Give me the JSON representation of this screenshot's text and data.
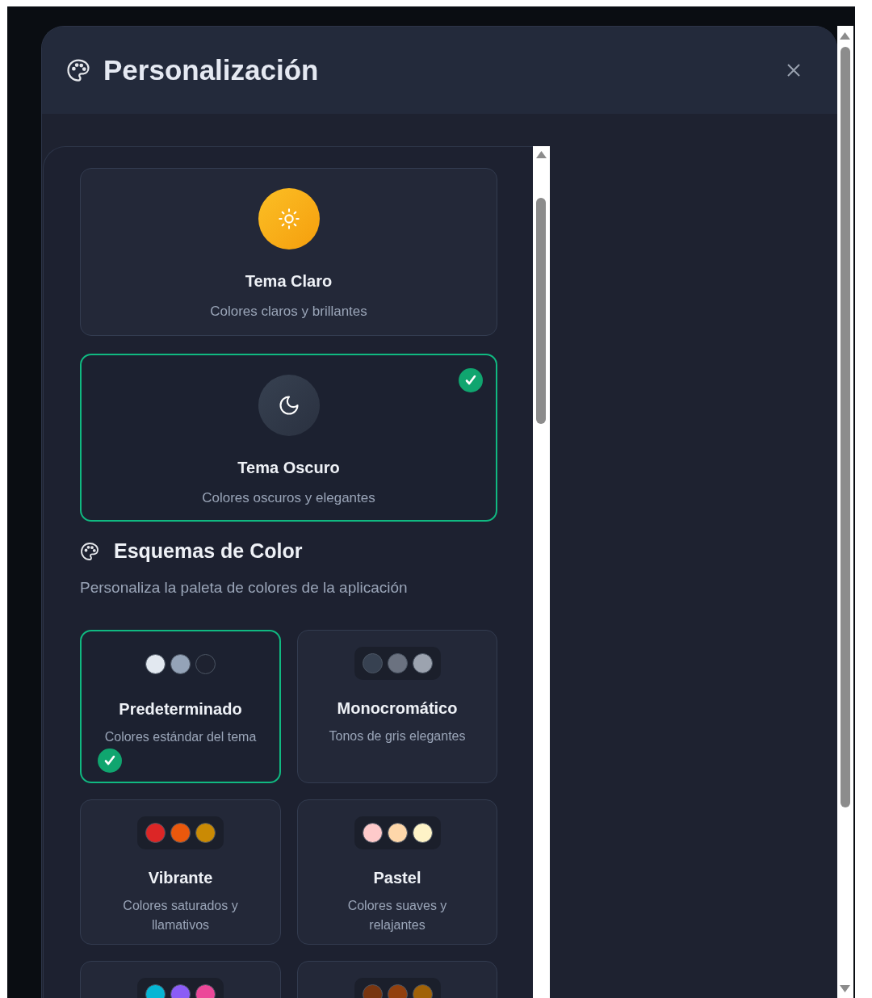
{
  "dialog": {
    "title": "Personalización"
  },
  "themes": [
    {
      "kind": "light",
      "title": "Tema Claro",
      "description": "Colores claros y brillantes",
      "selected": false
    },
    {
      "kind": "dark",
      "title": "Tema Oscuro",
      "description": "Colores oscuros y elegantes",
      "selected": true
    }
  ],
  "color_schemes_section": {
    "title": "Esquemas de Color",
    "description": "Personaliza la paleta de colores de la aplicación"
  },
  "schemes": [
    {
      "title": "Predeterminado",
      "description": "Colores estándar del tema",
      "selected": true,
      "swatches": [
        {
          "color": "#e2e8f0"
        },
        {
          "color": "#94a3b8"
        },
        {
          "color": "#1e2230"
        }
      ]
    },
    {
      "title": "Monocromático",
      "description": "Tonos de gris elegantes",
      "selected": false,
      "swatches": [
        {
          "color": "#374151"
        },
        {
          "color": "#6b7280"
        },
        {
          "color": "#9ca3af"
        }
      ]
    },
    {
      "title": "Vibrante",
      "description": "Colores saturados y llamativos",
      "selected": false,
      "swatches": [
        {
          "color": "#dc2626"
        },
        {
          "color": "#ea580c"
        },
        {
          "color": "#ca8a04"
        }
      ]
    },
    {
      "title": "Pastel",
      "description": "Colores suaves y relajantes",
      "selected": false,
      "swatches": [
        {
          "color": "#fecaca"
        },
        {
          "color": "#fed7aa"
        },
        {
          "color": "#fef3c7"
        }
      ]
    },
    {
      "selected": false,
      "swatches": [
        {
          "color": "#06b6d4"
        },
        {
          "color": "#8b5cf6"
        },
        {
          "color": "#ec4899"
        }
      ]
    },
    {
      "selected": false,
      "swatches": [
        {
          "color": "#78350f"
        },
        {
          "color": "#92400e"
        },
        {
          "color": "#a16207"
        }
      ]
    }
  ]
}
